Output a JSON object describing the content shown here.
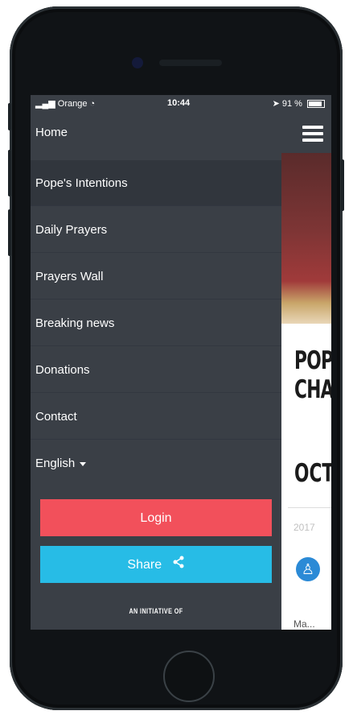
{
  "status_bar": {
    "carrier": "Orange",
    "time": "10:44",
    "battery": "91 %"
  },
  "menu": {
    "home": "Home",
    "items": [
      {
        "label": "Pope's Intentions"
      },
      {
        "label": "Daily Prayers"
      },
      {
        "label": "Prayers Wall"
      },
      {
        "label": "Breaking news"
      },
      {
        "label": "Donations"
      },
      {
        "label": "Contact"
      }
    ],
    "language": "English",
    "login_label": "Login",
    "share_label": "Share",
    "initiative_text": "AN INITIATIVE OF"
  },
  "content": {
    "title_line1": "POP",
    "title_line2": "CHA",
    "month": "OCT",
    "year": "2017",
    "logo_glyph": "♙",
    "more_text": "Ma..."
  },
  "colors": {
    "drawer": "#3a3f46",
    "login": "#f2505b",
    "share": "#27bce6"
  }
}
